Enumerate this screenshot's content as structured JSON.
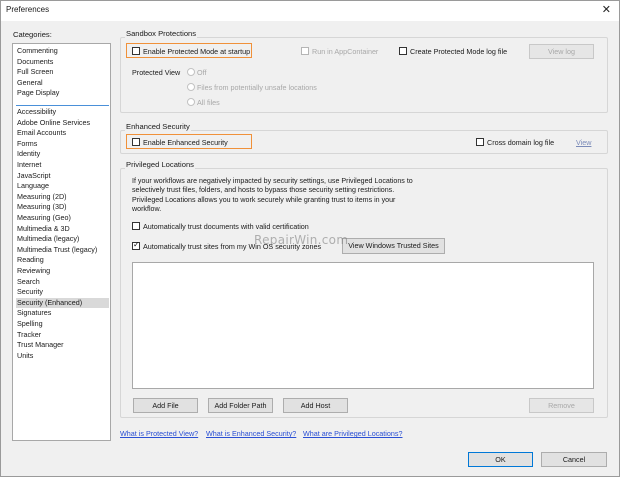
{
  "window": {
    "title": "Preferences",
    "close_glyph": "✕"
  },
  "categories": {
    "label": "Categories:",
    "group_a": [
      "Commenting",
      "Documents",
      "Full Screen",
      "General",
      "Page Display"
    ],
    "group_b": [
      "Accessibility",
      "Adobe Online Services",
      "Email Accounts",
      "Forms",
      "Identity",
      "Internet",
      "JavaScript",
      "Language",
      "Measuring (2D)",
      "Measuring (3D)",
      "Measuring (Geo)",
      "Multimedia & 3D",
      "Multimedia (legacy)",
      "Multimedia Trust (legacy)",
      "Reading",
      "Reviewing",
      "Search",
      "Security",
      "Security (Enhanced)",
      "Signatures",
      "Spelling",
      "Tracker",
      "Trust Manager",
      "Units"
    ],
    "selected": "Security (Enhanced)"
  },
  "sandbox": {
    "title": "Sandbox Protections",
    "protected_mode_label": "Enable Protected Mode at startup",
    "protected_mode_checked": false,
    "appcontainer_label": "Run in AppContainer",
    "create_log_label": "Create Protected Mode log file",
    "view_log_label": "View log",
    "protected_view_label": "Protected View",
    "radio_off": "Off",
    "radio_unsafe": "Files from potentially unsafe locations",
    "radio_all": "All files"
  },
  "enhanced": {
    "title": "Enhanced Security",
    "enable_label": "Enable Enhanced Security",
    "enable_checked": false,
    "cross_domain_label": "Cross domain log file",
    "view_label": "View"
  },
  "privileged": {
    "title": "Privileged Locations",
    "description_lines": [
      "If your workflows are negatively impacted by security settings, use Privileged Locations to",
      "selectively trust files, folders, and hosts to bypass those security setting restrictions.",
      "Privileged Locations allows you to work securely while granting trust to items in your",
      "workflow."
    ],
    "trust_cert_label": "Automatically trust documents with valid certification",
    "trust_cert_checked": false,
    "trust_sites_label": "Automatically trust sites from my Win OS security zones",
    "trust_sites_checked": true,
    "view_trusted_sites_label": "View Windows Trusted Sites",
    "add_file_label": "Add File",
    "add_folder_label": "Add Folder Path",
    "add_host_label": "Add Host",
    "remove_label": "Remove"
  },
  "links": {
    "protected_view": "What is Protected View?",
    "enhanced_security": "What is Enhanced Security?",
    "privileged_locations": "What are Privileged Locations?"
  },
  "footer": {
    "ok_label": "OK",
    "cancel_label": "Cancel"
  },
  "watermark": "RepairWin.com",
  "colors": {
    "highlight": "#f0913a",
    "link": "#2a4fd4",
    "selection": "#d9d9d9",
    "separator": "#4a90d9"
  }
}
